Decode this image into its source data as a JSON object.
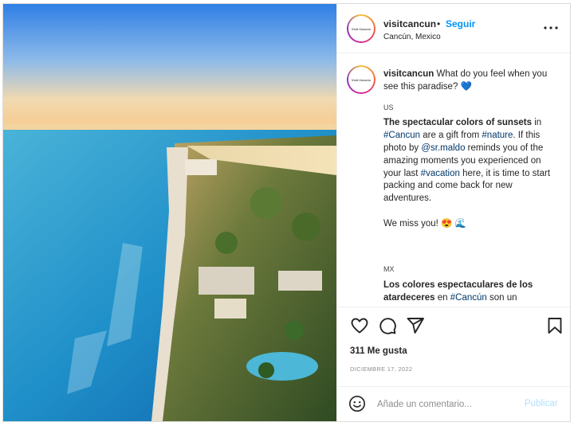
{
  "post": {
    "account": {
      "username": "visitcancun",
      "separator": "•",
      "follow_label": "Seguir",
      "location": "Cancún, Mexico",
      "avatar_text": "Visit Cancún"
    },
    "caption": {
      "username": "visitcancun",
      "intro": "What do you feel when you see this paradise?",
      "intro_emoji": "💙",
      "us_label": "US",
      "us_bold": "The spectacular colors of sunsets",
      "us_in": "in",
      "us_tag1": "#Cancun",
      "us_mid": "are a gift from",
      "us_tag2": "#nature",
      "us_mid2": ". If this photo by",
      "us_mention": "@sr.maldo",
      "us_mid3": "reminds you of the amazing moments you experienced on your last",
      "us_tag3": "#vacation",
      "us_end": "here, it is time to start packing and come back for new adventures.",
      "miss": "We miss you!",
      "miss_emojis": "😍 🌊",
      "mx_label": "MX",
      "mx_bold": "Los colores espectaculares de los atardeceres",
      "mx_en": "en",
      "mx_tag": "#Cancún",
      "mx_rest": "son un"
    },
    "likes": "311 Me gusta",
    "date": "DICIEMBRE 17, 2022",
    "comment": {
      "placeholder": "Añade un comentario...",
      "publish_label": "Publicar"
    }
  },
  "colors": {
    "follow": "#0095f6",
    "hashtag": "#00376b",
    "publish_disabled": "#b2dffc"
  },
  "icons": [
    "heart-icon",
    "comment-icon",
    "share-icon",
    "bookmark-icon",
    "emoji-icon",
    "more-icon"
  ]
}
